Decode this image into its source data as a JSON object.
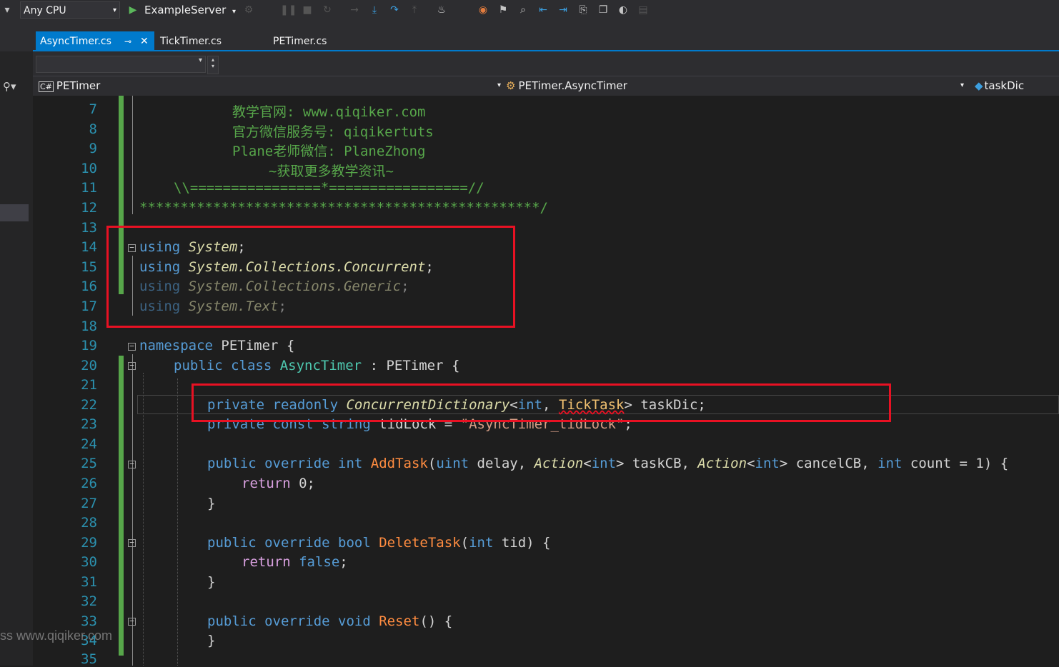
{
  "toolbar": {
    "platform": "Any CPU",
    "startup_project": "ExampleServer"
  },
  "tabs": [
    {
      "label": "AsyncTimer.cs",
      "active": true
    },
    {
      "label": "TickTimer.cs",
      "active": false
    },
    {
      "label": "PETimer.cs",
      "active": false
    }
  ],
  "navbar": {
    "project": "PETimer",
    "type": "PETimer.AsyncTimer",
    "member": "taskDic"
  },
  "line_numbers": [
    "7",
    "8",
    "9",
    "10",
    "11",
    "12",
    "13",
    "14",
    "15",
    "16",
    "17",
    "18",
    "19",
    "20",
    "21",
    "22",
    "23",
    "24",
    "25",
    "26",
    "27",
    "28",
    "29",
    "30",
    "31",
    "32",
    "33",
    "34",
    "35"
  ],
  "code": {
    "l7": "教学官网: www.qiqiker.com",
    "l8": "官方微信服务号: qiqikertuts",
    "l9": "Plane老师微信: PlaneZhong",
    "l10": "~获取更多教学资讯~",
    "l11": "\\\\================*=================//",
    "l12": "*************************************************/",
    "l14_kw": "using",
    "l14_ns": "System",
    "l14_end": ";",
    "l15_kw": "using",
    "l15_ns": "System.Collections.Concurrent",
    "l15_end": ";",
    "l16_kw": "using",
    "l16_ns": "System.Collections.Generic",
    "l16_end": ";",
    "l17_kw": "using",
    "l17_ns": "System.Text",
    "l17_end": ";",
    "l19_kw": "namespace",
    "l19_name": " PETimer {",
    "l20_kw": "public class",
    "l20_cls": "AsyncTimer",
    "l20_rest": " : PETimer {",
    "l22_kw": "private readonly",
    "l22_type": "ConcurrentDictionary",
    "l22_lt": "<",
    "l22_int": "int",
    "l22_comma": ", ",
    "l22_t2": "TickTask",
    "l22_rest": "> taskDic;",
    "l23_kw": "private const string",
    "l23_name": " tidLock = ",
    "l23_str": "\"AsyncTimer_tidLock\"",
    "l23_end": ";",
    "l25_kw": "public override int",
    "l25_meth": "AddTask",
    "l25_p1": "(",
    "l25_uint": "uint",
    "l25_p2": " delay, ",
    "l25_act1": "Action",
    "l25_p3": "<",
    "l25_int1": "int",
    "l25_p4": "> taskCB, ",
    "l25_act2": "Action",
    "l25_p5": "<",
    "l25_int2": "int",
    "l25_p6": "> cancelCB, ",
    "l25_int3": "int",
    "l25_p7": " count = 1) {",
    "l26_kw": "return",
    "l26_rest": " 0;",
    "l27": "}",
    "l29_kw": "public override bool",
    "l29_meth": "DeleteTask",
    "l29_p1": "(",
    "l29_int": "int",
    "l29_p2": " tid) {",
    "l30_kw": "return",
    "l30_val": " false",
    "l30_end": ";",
    "l31": "}",
    "l33_kw": "public override void",
    "l33_meth": "Reset",
    "l33_rest": "() {",
    "l34": "}"
  },
  "watermark": "ss www.qiqiker.com"
}
